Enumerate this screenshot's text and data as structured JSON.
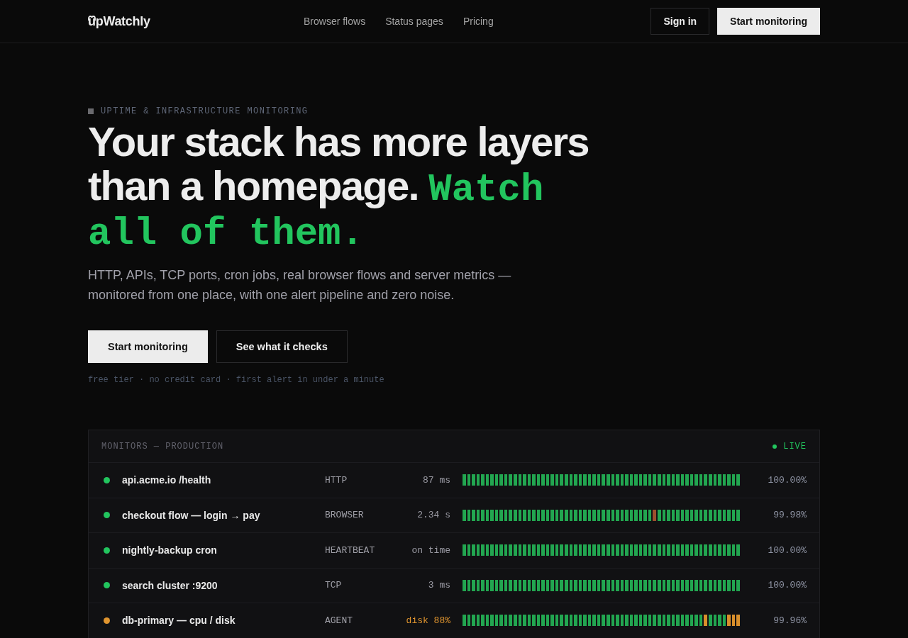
{
  "header": {
    "logo": "upWatchly",
    "nav": [
      "Browser flows",
      "Status pages",
      "Pricing"
    ],
    "sign_in": "Sign in",
    "cta": "Start monitoring"
  },
  "hero": {
    "eyebrow": "UPTIME & INFRASTRUCTURE MONITORING",
    "headline": "Your stack has more layers than a homepage. **Watch all of them.**",
    "subtitle": "HTTP, APIs, TCP ports, cron jobs, real browser flows and server metrics — monitored from one place, with one alert pipeline and zero noise.",
    "primary_button": "Start monitoring",
    "secondary_button": "See what it checks",
    "note": "free tier · no credit card · first alert in under a minute"
  },
  "monitors": {
    "title": "MONITORS — PRODUCTION",
    "live_label": "LIVE",
    "rows": [
      {
        "name": "api.acme.io /health",
        "color": "#22c55e",
        "degraded": false,
        "type": "HTTP",
        "response": "87 ms",
        "uptime": "100.00%",
        "checks": [
          {
            "color": "#22a650"
          },
          {
            "color": "#22a650"
          },
          {
            "color": "#22a650"
          },
          {
            "color": "#22a650"
          },
          {
            "color": "#22a650"
          },
          {
            "color": "#22a650"
          },
          {
            "color": "#22a650"
          },
          {
            "color": "#22a650"
          },
          {
            "color": "#22a650"
          },
          {
            "color": "#22a650"
          },
          {
            "color": "#22a650"
          },
          {
            "color": "#22a650"
          },
          {
            "color": "#22a650"
          },
          {
            "color": "#22a650"
          },
          {
            "color": "#22a650"
          },
          {
            "color": "#22a650"
          },
          {
            "color": "#22a650"
          },
          {
            "color": "#22a650"
          },
          {
            "color": "#22a650"
          },
          {
            "color": "#22a650"
          },
          {
            "color": "#22a650"
          },
          {
            "color": "#22a650"
          },
          {
            "color": "#22a650"
          },
          {
            "color": "#22a650"
          },
          {
            "color": "#22a650"
          },
          {
            "color": "#22a650"
          },
          {
            "color": "#22a650"
          },
          {
            "color": "#22a650"
          },
          {
            "color": "#22a650"
          },
          {
            "color": "#22a650"
          },
          {
            "color": "#22a650"
          },
          {
            "color": "#22a650"
          },
          {
            "color": "#22a650"
          },
          {
            "color": "#22a650"
          },
          {
            "color": "#22a650"
          },
          {
            "color": "#22a650"
          },
          {
            "color": "#22a650"
          },
          {
            "color": "#22a650"
          },
          {
            "color": "#22a650"
          },
          {
            "color": "#22a650"
          },
          {
            "color": "#22a650"
          },
          {
            "color": "#22a650"
          },
          {
            "color": "#22a650"
          },
          {
            "color": "#22a650"
          },
          {
            "color": "#22a650"
          },
          {
            "color": "#22a650"
          },
          {
            "color": "#22a650"
          },
          {
            "color": "#22a650"
          },
          {
            "color": "#22a650"
          },
          {
            "color": "#22a650"
          },
          {
            "color": "#22a650"
          },
          {
            "color": "#22a650"
          },
          {
            "color": "#22a650"
          },
          {
            "color": "#22a650"
          },
          {
            "color": "#22a650"
          },
          {
            "color": "#22a650"
          },
          {
            "color": "#22a650"
          },
          {
            "color": "#22a650"
          },
          {
            "color": "#22a650"
          },
          {
            "color": "#22a650"
          }
        ]
      },
      {
        "name": "checkout flow — login → pay",
        "color": "#22c55e",
        "degraded": false,
        "type": "BROWSER",
        "response": "2.34 s",
        "uptime": "99.98%",
        "checks": [
          {
            "color": "#22a650"
          },
          {
            "color": "#22a650"
          },
          {
            "color": "#22a650"
          },
          {
            "color": "#22a650"
          },
          {
            "color": "#22a650"
          },
          {
            "color": "#22a650"
          },
          {
            "color": "#22a650"
          },
          {
            "color": "#22a650"
          },
          {
            "color": "#22a650"
          },
          {
            "color": "#22a650"
          },
          {
            "color": "#22a650"
          },
          {
            "color": "#22a650"
          },
          {
            "color": "#22a650"
          },
          {
            "color": "#22a650"
          },
          {
            "color": "#22a650"
          },
          {
            "color": "#22a650"
          },
          {
            "color": "#22a650"
          },
          {
            "color": "#22a650"
          },
          {
            "color": "#22a650"
          },
          {
            "color": "#22a650"
          },
          {
            "color": "#22a650"
          },
          {
            "color": "#22a650"
          },
          {
            "color": "#22a650"
          },
          {
            "color": "#22a650"
          },
          {
            "color": "#22a650"
          },
          {
            "color": "#22a650"
          },
          {
            "color": "#22a650"
          },
          {
            "color": "#22a650"
          },
          {
            "color": "#22a650"
          },
          {
            "color": "#22a650"
          },
          {
            "color": "#22a650"
          },
          {
            "color": "#22a650"
          },
          {
            "color": "#22a650"
          },
          {
            "color": "#22a650"
          },
          {
            "color": "#22a650"
          },
          {
            "color": "#22a650"
          },
          {
            "color": "#22a650"
          },
          {
            "color": "#22a650"
          },
          {
            "color": "#22a650"
          },
          {
            "color": "#22a650"
          },
          {
            "color": "#22a650"
          },
          {
            "color": "#9c4f2e"
          },
          {
            "color": "#22a650"
          },
          {
            "color": "#22a650"
          },
          {
            "color": "#22a650"
          },
          {
            "color": "#22a650"
          },
          {
            "color": "#22a650"
          },
          {
            "color": "#22a650"
          },
          {
            "color": "#22a650"
          },
          {
            "color": "#22a650"
          },
          {
            "color": "#22a650"
          },
          {
            "color": "#22a650"
          },
          {
            "color": "#22a650"
          },
          {
            "color": "#22a650"
          },
          {
            "color": "#22a650"
          },
          {
            "color": "#22a650"
          },
          {
            "color": "#22a650"
          },
          {
            "color": "#22a650"
          },
          {
            "color": "#22a650"
          },
          {
            "color": "#22a650"
          }
        ]
      },
      {
        "name": "nightly-backup cron",
        "color": "#22c55e",
        "degraded": false,
        "type": "HEARTBEAT",
        "response": "on time",
        "uptime": "100.00%",
        "checks": [
          {
            "color": "#22a650"
          },
          {
            "color": "#22a650"
          },
          {
            "color": "#22a650"
          },
          {
            "color": "#22a650"
          },
          {
            "color": "#22a650"
          },
          {
            "color": "#22a650"
          },
          {
            "color": "#22a650"
          },
          {
            "color": "#22a650"
          },
          {
            "color": "#22a650"
          },
          {
            "color": "#22a650"
          },
          {
            "color": "#22a650"
          },
          {
            "color": "#22a650"
          },
          {
            "color": "#22a650"
          },
          {
            "color": "#22a650"
          },
          {
            "color": "#22a650"
          },
          {
            "color": "#22a650"
          },
          {
            "color": "#22a650"
          },
          {
            "color": "#22a650"
          },
          {
            "color": "#22a650"
          },
          {
            "color": "#22a650"
          },
          {
            "color": "#22a650"
          },
          {
            "color": "#22a650"
          },
          {
            "color": "#22a650"
          },
          {
            "color": "#22a650"
          },
          {
            "color": "#22a650"
          },
          {
            "color": "#22a650"
          },
          {
            "color": "#22a650"
          },
          {
            "color": "#22a650"
          },
          {
            "color": "#22a650"
          },
          {
            "color": "#22a650"
          },
          {
            "color": "#22a650"
          },
          {
            "color": "#22a650"
          },
          {
            "color": "#22a650"
          },
          {
            "color": "#22a650"
          },
          {
            "color": "#22a650"
          },
          {
            "color": "#22a650"
          },
          {
            "color": "#22a650"
          },
          {
            "color": "#22a650"
          },
          {
            "color": "#22a650"
          },
          {
            "color": "#22a650"
          },
          {
            "color": "#22a650"
          },
          {
            "color": "#22a650"
          },
          {
            "color": "#22a650"
          },
          {
            "color": "#22a650"
          },
          {
            "color": "#22a650"
          },
          {
            "color": "#22a650"
          },
          {
            "color": "#22a650"
          },
          {
            "color": "#22a650"
          },
          {
            "color": "#22a650"
          },
          {
            "color": "#22a650"
          },
          {
            "color": "#22a650"
          },
          {
            "color": "#22a650"
          },
          {
            "color": "#22a650"
          },
          {
            "color": "#22a650"
          },
          {
            "color": "#22a650"
          },
          {
            "color": "#22a650"
          },
          {
            "color": "#22a650"
          },
          {
            "color": "#22a650"
          },
          {
            "color": "#22a650"
          },
          {
            "color": "#22a650"
          }
        ]
      },
      {
        "name": "search cluster :9200",
        "color": "#22c55e",
        "degraded": false,
        "type": "TCP",
        "response": "3 ms",
        "uptime": "100.00%",
        "checks": [
          {
            "color": "#22a650"
          },
          {
            "color": "#22a650"
          },
          {
            "color": "#22a650"
          },
          {
            "color": "#22a650"
          },
          {
            "color": "#22a650"
          },
          {
            "color": "#22a650"
          },
          {
            "color": "#22a650"
          },
          {
            "color": "#22a650"
          },
          {
            "color": "#22a650"
          },
          {
            "color": "#22a650"
          },
          {
            "color": "#22a650"
          },
          {
            "color": "#22a650"
          },
          {
            "color": "#22a650"
          },
          {
            "color": "#22a650"
          },
          {
            "color": "#22a650"
          },
          {
            "color": "#22a650"
          },
          {
            "color": "#22a650"
          },
          {
            "color": "#22a650"
          },
          {
            "color": "#22a650"
          },
          {
            "color": "#22a650"
          },
          {
            "color": "#22a650"
          },
          {
            "color": "#22a650"
          },
          {
            "color": "#22a650"
          },
          {
            "color": "#22a650"
          },
          {
            "color": "#22a650"
          },
          {
            "color": "#22a650"
          },
          {
            "color": "#22a650"
          },
          {
            "color": "#22a650"
          },
          {
            "color": "#22a650"
          },
          {
            "color": "#22a650"
          },
          {
            "color": "#22a650"
          },
          {
            "color": "#22a650"
          },
          {
            "color": "#22a650"
          },
          {
            "color": "#22a650"
          },
          {
            "color": "#22a650"
          },
          {
            "color": "#22a650"
          },
          {
            "color": "#22a650"
          },
          {
            "color": "#22a650"
          },
          {
            "color": "#22a650"
          },
          {
            "color": "#22a650"
          },
          {
            "color": "#22a650"
          },
          {
            "color": "#22a650"
          },
          {
            "color": "#22a650"
          },
          {
            "color": "#22a650"
          },
          {
            "color": "#22a650"
          },
          {
            "color": "#22a650"
          },
          {
            "color": "#22a650"
          },
          {
            "color": "#22a650"
          },
          {
            "color": "#22a650"
          },
          {
            "color": "#22a650"
          },
          {
            "color": "#22a650"
          },
          {
            "color": "#22a650"
          },
          {
            "color": "#22a650"
          },
          {
            "color": "#22a650"
          },
          {
            "color": "#22a650"
          },
          {
            "color": "#22a650"
          },
          {
            "color": "#22a650"
          },
          {
            "color": "#22a650"
          },
          {
            "color": "#22a650"
          },
          {
            "color": "#22a650"
          }
        ]
      },
      {
        "name": "db-primary — cpu / disk",
        "color": "#e0952f",
        "degraded": true,
        "type": "AGENT",
        "response": "disk 88%",
        "uptime": "99.96%",
        "checks": [
          {
            "color": "#22a650"
          },
          {
            "color": "#22a650"
          },
          {
            "color": "#22a650"
          },
          {
            "color": "#22a650"
          },
          {
            "color": "#22a650"
          },
          {
            "color": "#22a650"
          },
          {
            "color": "#22a650"
          },
          {
            "color": "#22a650"
          },
          {
            "color": "#22a650"
          },
          {
            "color": "#22a650"
          },
          {
            "color": "#22a650"
          },
          {
            "color": "#22a650"
          },
          {
            "color": "#22a650"
          },
          {
            "color": "#22a650"
          },
          {
            "color": "#22a650"
          },
          {
            "color": "#22a650"
          },
          {
            "color": "#22a650"
          },
          {
            "color": "#22a650"
          },
          {
            "color": "#22a650"
          },
          {
            "color": "#22a650"
          },
          {
            "color": "#22a650"
          },
          {
            "color": "#22a650"
          },
          {
            "color": "#22a650"
          },
          {
            "color": "#22a650"
          },
          {
            "color": "#22a650"
          },
          {
            "color": "#22a650"
          },
          {
            "color": "#22a650"
          },
          {
            "color": "#22a650"
          },
          {
            "color": "#22a650"
          },
          {
            "color": "#22a650"
          },
          {
            "color": "#22a650"
          },
          {
            "color": "#22a650"
          },
          {
            "color": "#22a650"
          },
          {
            "color": "#22a650"
          },
          {
            "color": "#22a650"
          },
          {
            "color": "#22a650"
          },
          {
            "color": "#22a650"
          },
          {
            "color": "#22a650"
          },
          {
            "color": "#22a650"
          },
          {
            "color": "#22a650"
          },
          {
            "color": "#22a650"
          },
          {
            "color": "#22a650"
          },
          {
            "color": "#22a650"
          },
          {
            "color": "#22a650"
          },
          {
            "color": "#22a650"
          },
          {
            "color": "#22a650"
          },
          {
            "color": "#22a650"
          },
          {
            "color": "#22a650"
          },
          {
            "color": "#22a650"
          },
          {
            "color": "#22a650"
          },
          {
            "color": "#22a650"
          },
          {
            "color": "#22a650"
          },
          {
            "color": "#d98f2b"
          },
          {
            "color": "#22a650"
          },
          {
            "color": "#22a650"
          },
          {
            "color": "#22a650"
          },
          {
            "color": "#22a650"
          },
          {
            "color": "#d98f2b"
          },
          {
            "color": "#d98f2b"
          },
          {
            "color": "#d98f2b"
          }
        ]
      }
    ]
  }
}
